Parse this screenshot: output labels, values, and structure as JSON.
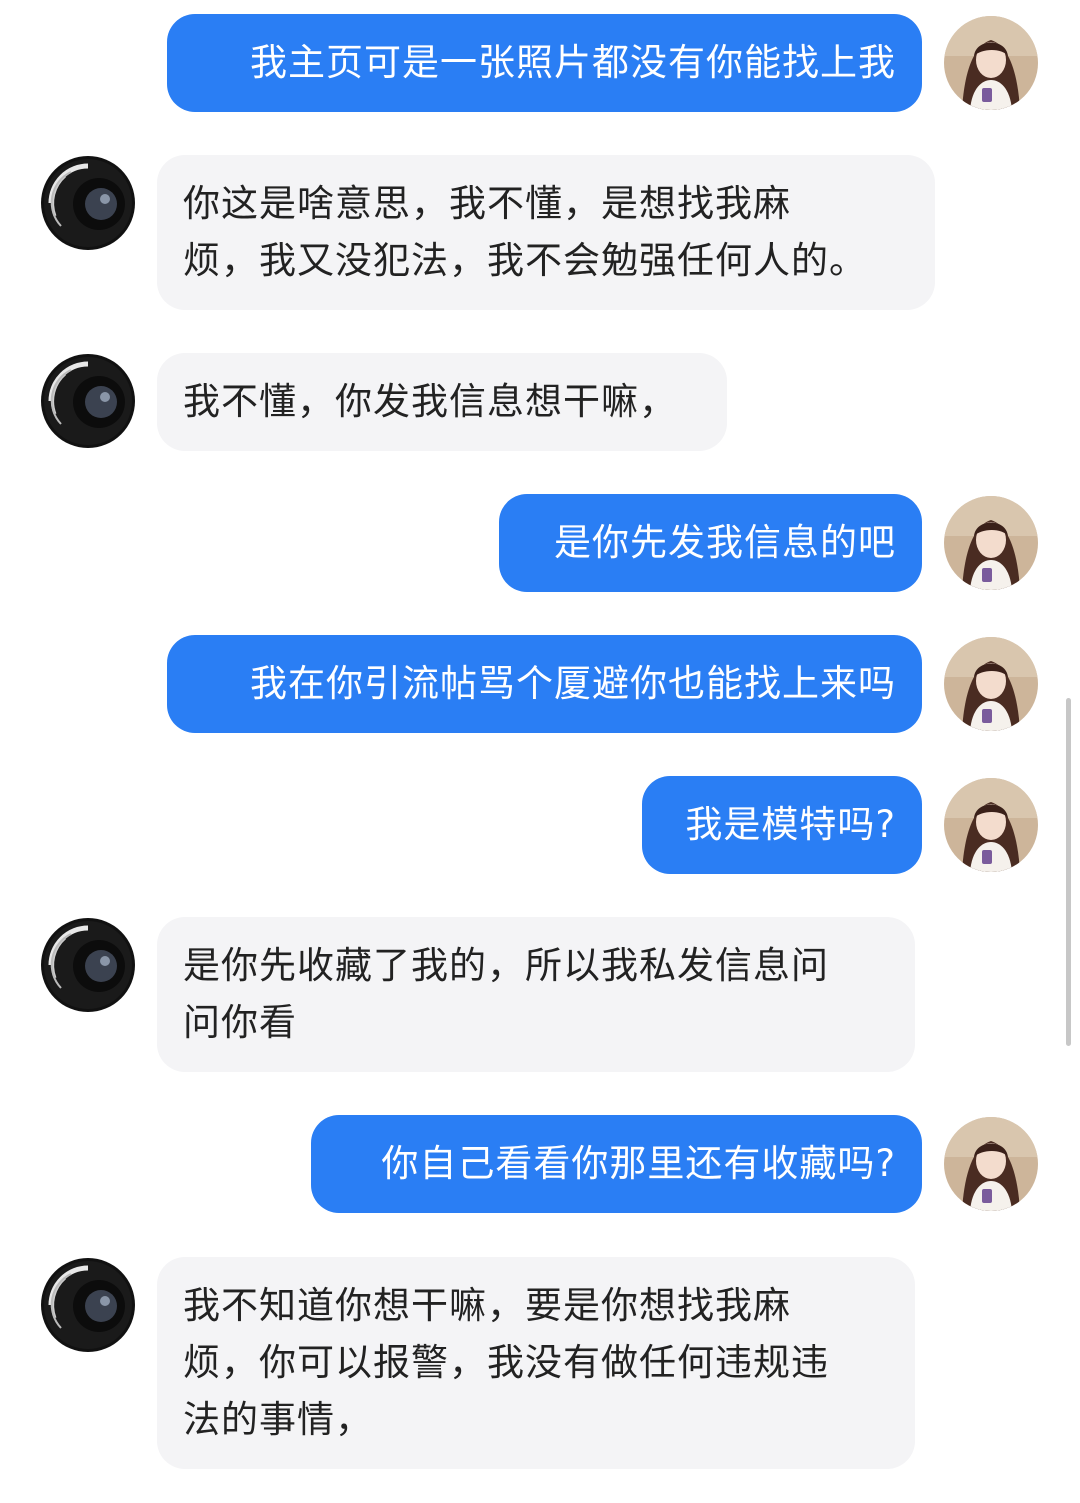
{
  "messages": [
    {
      "side": "out",
      "text": "我主页可是一张照片都没有你能找上我"
    },
    {
      "side": "in",
      "text": "你这是啥意思，我不懂，是想找我麻\n烦，我又没犯法，我不会勉强任何人的。"
    },
    {
      "side": "in",
      "text": "我不懂，你发我信息想干嘛，"
    },
    {
      "side": "out",
      "text": "是你先发我信息的吧"
    },
    {
      "side": "out",
      "text": "我在你引流帖骂个厦避你也能找上来吗"
    },
    {
      "side": "out",
      "text": "我是模特吗?"
    },
    {
      "side": "in",
      "text": "是你先收藏了我的，所以我私发信息问\n问你看"
    },
    {
      "side": "out",
      "text": "你自己看看你那里还有收藏吗?"
    },
    {
      "side": "in",
      "text": "我不知道你想干嘛，要是你想找我麻\n烦，你可以报警，我没有做任何违规违\n法的事情，"
    }
  ],
  "avatars": {
    "self": {
      "icon": "girl-portrait-avatar",
      "colors": {
        "bg": "#cdb59a",
        "hair": "#4a2c22",
        "skin": "#f3dccd",
        "clothes": "#f5f1ec"
      }
    },
    "other": {
      "icon": "camera-lens-avatar",
      "colors": {
        "bg": "#111111",
        "ring": "#e8e8e8",
        "glass": "#3b4250"
      }
    }
  },
  "theme": {
    "outgoing_bubble": "#2a7ef4",
    "incoming_bubble": "#f4f4f6"
  }
}
